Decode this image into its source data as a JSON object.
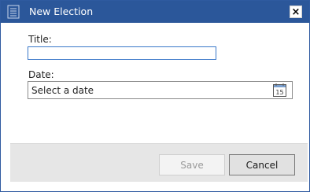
{
  "window": {
    "title": "New Election",
    "close_symbol": "×",
    "app_icon": "document-icon",
    "titlebar_color": "#2b579a"
  },
  "form": {
    "title_label": "Title:",
    "title_value": "",
    "date_label": "Date:",
    "date_placeholder": "Select a date",
    "calendar_icon_day": "15"
  },
  "footer": {
    "save_label": "Save",
    "cancel_label": "Cancel",
    "save_enabled": false
  }
}
